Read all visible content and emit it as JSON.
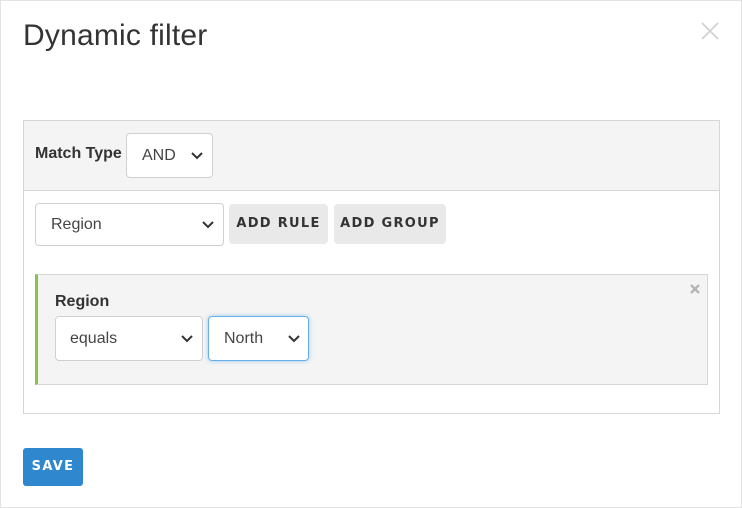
{
  "dialog": {
    "title": "Dynamic filter",
    "close_icon": "close-icon"
  },
  "panel": {
    "match_type_label": "Match Type",
    "match_type_value": "AND",
    "field_select_value": "Region",
    "add_rule_label": "ADD RULE",
    "add_group_label": "ADD GROUP"
  },
  "rule": {
    "label": "Region",
    "operator_value": "equals",
    "value_value": "North",
    "remove_icon": "close-icon",
    "accent_color": "#8bc34a"
  },
  "footer": {
    "save_label": "SAVE",
    "save_color": "#2f87cd"
  }
}
